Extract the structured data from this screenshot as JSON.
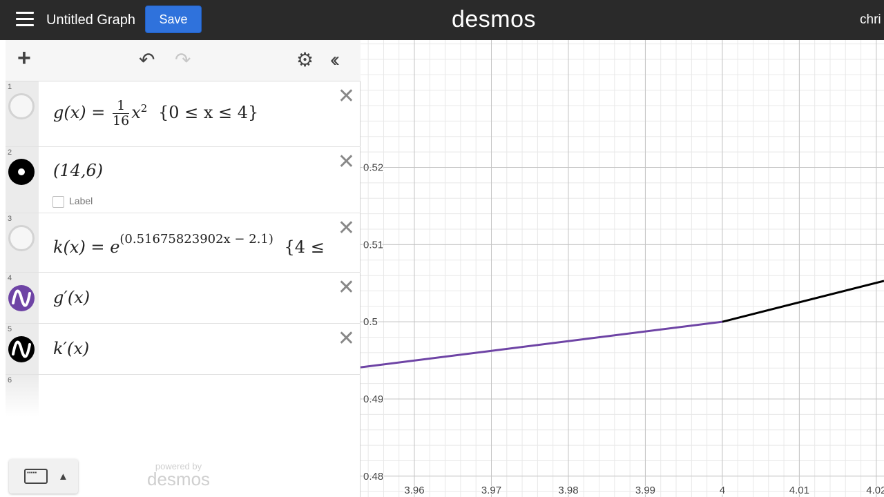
{
  "header": {
    "title": "Untitled Graph",
    "save_label": "Save",
    "brand": "desmos",
    "user": "chri"
  },
  "toolbar": {
    "add_icon": "plus-icon",
    "undo_icon": "undo-icon",
    "redo_icon": "redo-icon",
    "settings_icon": "gear-icon",
    "collapse_icon": "double-chevron-left-icon"
  },
  "expressions": [
    {
      "num": "1",
      "lhs": "g(x) =",
      "frac_num": "1",
      "frac_den": "16",
      "rest": "x",
      "sup": "2",
      "cond": "{0 ≤ x ≤ 4}",
      "color": "#d3d3d3"
    },
    {
      "num": "2",
      "text": "(14,6)",
      "label": "Label",
      "color": "#000000"
    },
    {
      "num": "3",
      "lhs": "k(x) =",
      "base": "e",
      "sup": "(0.51675823902x − 2.1)",
      "cond": "{4 ≤",
      "color": "#d3d3d3"
    },
    {
      "num": "4",
      "text": "g′(x)",
      "color": "#6e44a5"
    },
    {
      "num": "5",
      "text": "k′(x)",
      "color": "#000000"
    },
    {
      "num": "6"
    }
  ],
  "footer": {
    "powered_by": "powered by",
    "brand": "desmos"
  },
  "graph": {
    "y_ticks": [
      "0.52",
      "0.51",
      "0.5",
      "0.49",
      "0.48"
    ],
    "x_ticks": [
      "3.96",
      "3.97",
      "3.98",
      "3.99",
      "4",
      "4.01",
      "4.02"
    ]
  },
  "chart_data": {
    "type": "line",
    "x_range": [
      3.953,
      4.021
    ],
    "y_range": [
      0.4773,
      0.5365
    ],
    "series": [
      {
        "color": "#6e44a5",
        "x": [
          3.953,
          4.0
        ],
        "y": [
          0.4941,
          0.5
        ]
      },
      {
        "color": "#000000",
        "x": [
          4.0,
          4.021
        ],
        "y": [
          0.5,
          0.5053
        ]
      }
    ]
  }
}
